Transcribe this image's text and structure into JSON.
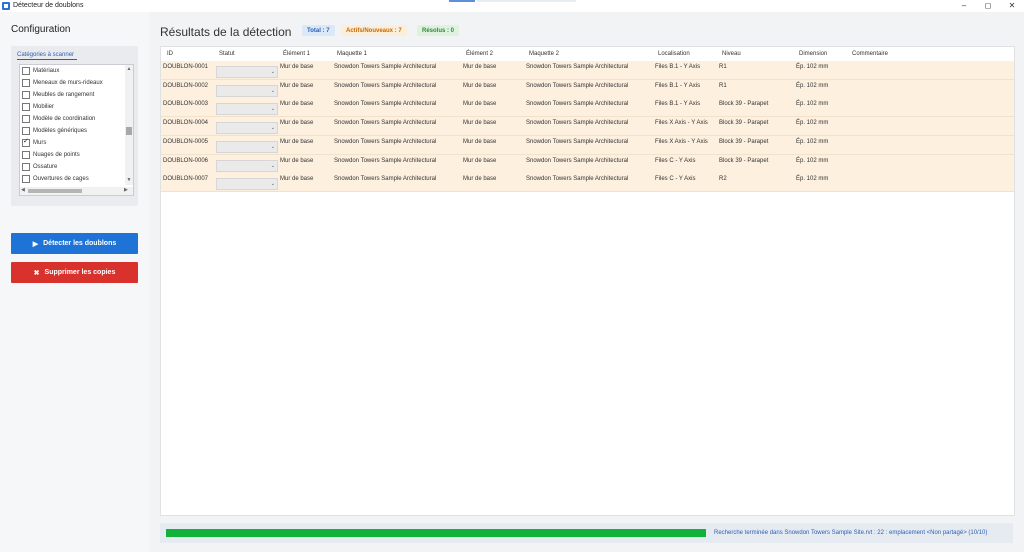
{
  "window": {
    "title": "Détecteur de doublons",
    "minimize": "–",
    "restore": "◻",
    "close": "✕"
  },
  "sidebar": {
    "title": "Configuration",
    "categories_label": "Catégories à scanner",
    "categories": [
      {
        "label": "Matériaux",
        "checked": false
      },
      {
        "label": "Meneaux de murs-rideaux",
        "checked": false
      },
      {
        "label": "Meubles de rangement",
        "checked": false
      },
      {
        "label": "Mobilier",
        "checked": false
      },
      {
        "label": "Modèle de coordination",
        "checked": false
      },
      {
        "label": "Modèles génériques",
        "checked": false
      },
      {
        "label": "Murs",
        "checked": true
      },
      {
        "label": "Nuages de points",
        "checked": false
      },
      {
        "label": "Ossature",
        "checked": false
      },
      {
        "label": "Ouvertures de cages",
        "checked": false
      }
    ],
    "detect_button": "Détecter les doublons",
    "delete_button": "Supprimer les copies"
  },
  "main": {
    "title": "Résultats de la détection",
    "badges": {
      "total": "Total : 7",
      "active": "Actifs/Nouveaux : 7",
      "resolved": "Résolus : 0"
    },
    "columns": [
      "ID",
      "Statut",
      "Élément 1",
      "Maquette 1",
      "Élément 2",
      "Maquette 2",
      "Localisation",
      "Niveau",
      "Dimension",
      "Commentaire"
    ],
    "rows": [
      {
        "id": "DOUBLON-0001",
        "status": "",
        "el1": "Mur de base",
        "model1": "Snowdon Towers Sample Architectural",
        "el2": "Mur de base",
        "model2": "Snowdon Towers Sample Architectural",
        "location": "Files B.1 - Y Axis",
        "level": "R1",
        "dimension": "Ép. 102 mm",
        "comment": ""
      },
      {
        "id": "DOUBLON-0002",
        "status": "",
        "el1": "Mur de base",
        "model1": "Snowdon Towers Sample Architectural",
        "el2": "Mur de base",
        "model2": "Snowdon Towers Sample Architectural",
        "location": "Files B.1 - Y Axis",
        "level": "R1",
        "dimension": "Ép. 102 mm",
        "comment": ""
      },
      {
        "id": "DOUBLON-0003",
        "status": "",
        "el1": "Mur de base",
        "model1": "Snowdon Towers Sample Architectural",
        "el2": "Mur de base",
        "model2": "Snowdon Towers Sample Architectural",
        "location": "Files B.1 - Y Axis",
        "level": "Block 39 - Parapet",
        "dimension": "Ép. 102 mm",
        "comment": ""
      },
      {
        "id": "DOUBLON-0004",
        "status": "",
        "el1": "Mur de base",
        "model1": "Snowdon Towers Sample Architectural",
        "el2": "Mur de base",
        "model2": "Snowdon Towers Sample Architectural",
        "location": "Files X Axis - Y Axis",
        "level": "Block 39 - Parapet",
        "dimension": "Ép. 102 mm",
        "comment": ""
      },
      {
        "id": "DOUBLON-0005",
        "status": "",
        "el1": "Mur de base",
        "model1": "Snowdon Towers Sample Architectural",
        "el2": "Mur de base",
        "model2": "Snowdon Towers Sample Architectural",
        "location": "Files X Axis - Y Axis",
        "level": "Block 39 - Parapet",
        "dimension": "Ép. 102 mm",
        "comment": ""
      },
      {
        "id": "DOUBLON-0006",
        "status": "",
        "el1": "Mur de base",
        "model1": "Snowdon Towers Sample Architectural",
        "el2": "Mur de base",
        "model2": "Snowdon Towers Sample Architectural",
        "location": "Files C - Y Axis",
        "level": "Block 39 - Parapet",
        "dimension": "Ép. 102 mm",
        "comment": ""
      },
      {
        "id": "DOUBLON-0007",
        "status": "",
        "el1": "Mur de base",
        "model1": "Snowdon Towers Sample Architectural",
        "el2": "Mur de base",
        "model2": "Snowdon Towers Sample Architectural",
        "location": "Files C - Y Axis",
        "level": "R2",
        "dimension": "Ép. 102 mm",
        "comment": ""
      }
    ]
  },
  "statusbar": {
    "progress": 1.0,
    "text": "Recherche terminée dans Snowdon Towers Sample Site.rvt : 22 : emplacement <Non partagé> (10/10)"
  },
  "colors": {
    "accent": "#1f73d6",
    "danger": "#d9312c",
    "progress": "#11b23a",
    "row_highlight": "#fdf0df"
  },
  "icons": {
    "detect": "play-icon",
    "delete": "x-icon"
  }
}
